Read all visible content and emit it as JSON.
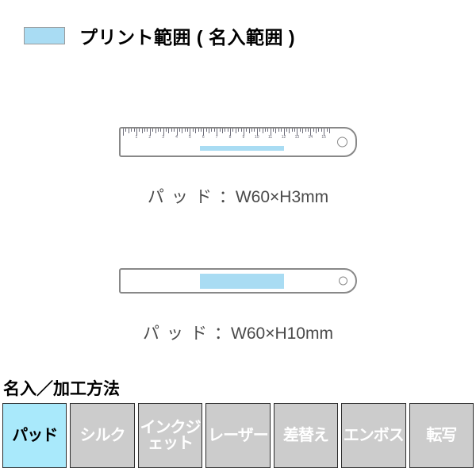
{
  "legend": {
    "swatch_color": "#a9dcf3",
    "label": "プリント範囲 ( 名入範囲 )"
  },
  "diagrams": [
    {
      "name": "ruler-front-scale",
      "caption_kana": "パッド",
      "caption_spec": "：W60×H3mm",
      "print_area": {
        "width_mm": 60,
        "height_mm": 3
      },
      "scale_numbers": [
        1,
        2,
        3,
        4,
        5,
        6,
        7,
        8,
        9,
        10,
        11,
        12,
        13,
        14,
        15
      ],
      "has_scale": "true",
      "has_hole": "true"
    },
    {
      "name": "ruler-back-plain",
      "caption_kana": "パッド",
      "caption_spec": "：W60×H10mm",
      "print_area": {
        "width_mm": 60,
        "height_mm": 10
      },
      "scale_numbers": [],
      "has_scale": "false",
      "has_hole": "true"
    }
  ],
  "methods": {
    "heading": "名入／加工方法",
    "active_color": "#a9e9fb",
    "inactive_color": "#cccccc",
    "items": [
      {
        "label": "パッド",
        "active": true
      },
      {
        "label": "シルク",
        "active": false
      },
      {
        "label": "インクジェット",
        "active": false
      },
      {
        "label": "レーザー",
        "active": false
      },
      {
        "label": "差替え",
        "active": false
      },
      {
        "label": "エンボス",
        "active": false
      },
      {
        "label": "転写",
        "active": false
      }
    ]
  }
}
